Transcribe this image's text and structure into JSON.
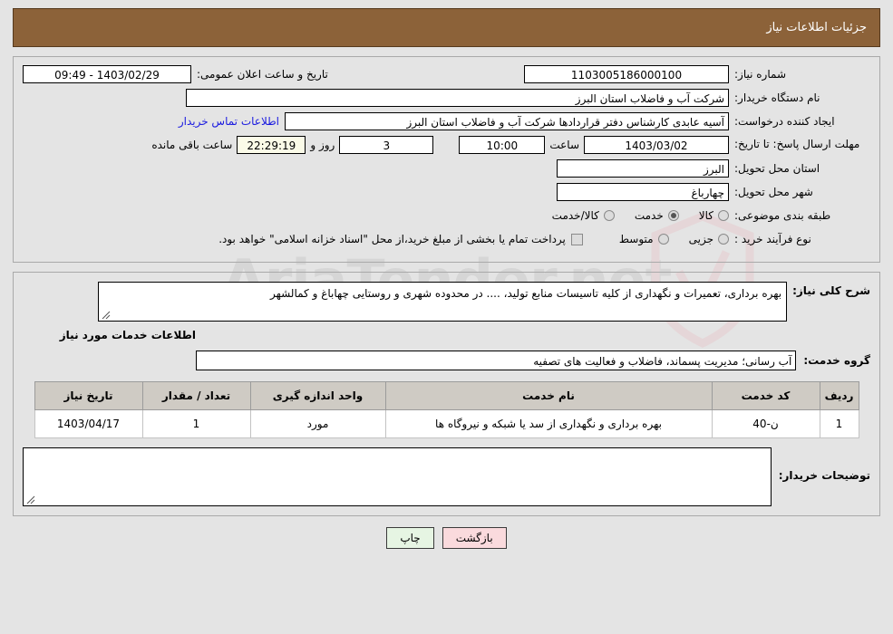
{
  "header": {
    "title": "جزئیات اطلاعات نیاز",
    "bg_color": "#8c6239",
    "text_color": "#ffffff"
  },
  "watermark": {
    "text": "AriaTender.net"
  },
  "form": {
    "need_number": {
      "label": "شماره نیاز:",
      "value": "1103005186000100"
    },
    "announce_datetime": {
      "label": "تاریخ و ساعت اعلان عمومی:",
      "value": "1403/02/29 - 09:49"
    },
    "buyer_org": {
      "label": "نام دستگاه خریدار:",
      "value": "شرکت آب و فاضلاب استان البرز"
    },
    "request_creator": {
      "label": "ایجاد کننده درخواست:",
      "value": "آسیه عابدی کارشناس دفتر قراردادها شرکت آب و فاضلاب استان البرز"
    },
    "empty_field": {
      "value": ""
    },
    "contact_link": {
      "label": "اطلاعات تماس خریدار",
      "color": "#1a1ae0"
    },
    "deadline": {
      "label": "مهلت ارسال پاسخ: تا تاریخ:",
      "date": "1403/03/02",
      "time_label": "ساعت",
      "time": "10:00",
      "days": "3",
      "days_label": "روز و",
      "countdown": "22:29:19",
      "countdown_suffix": "ساعت باقی مانده"
    },
    "delivery_province": {
      "label": "استان محل تحویل:",
      "value": "البرز"
    },
    "delivery_city": {
      "label": "شهر محل تحویل:",
      "value": "چهارباغ"
    },
    "subject_category": {
      "label": "طبقه بندی موضوعی:",
      "options": [
        "کالا",
        "خدمت",
        "کالا/خدمت"
      ],
      "selected": "خدمت"
    },
    "purchase_process": {
      "label": "نوع فرآیند خرید :",
      "options": [
        "جزیی",
        "متوسط"
      ],
      "selected": ""
    },
    "treasury_note": {
      "checked": false,
      "text": "پرداخت تمام یا بخشی از مبلغ خرید،از محل \"اسناد خزانه اسلامی\" خواهد بود."
    }
  },
  "details": {
    "general_description": {
      "label": "شرح کلی نیاز:",
      "value": "بهره برداری، تعمیرات و نگهداری از کلیه تاسیسات منابع تولید، .... در محدوده شهری و روستایی چهاباغ و کمالشهر"
    },
    "section_title": "اطلاعات خدمات مورد نیاز",
    "service_group": {
      "label": "گروه خدمت:",
      "value": "آب رسانی؛ مدیریت پسماند، فاضلاب و فعالیت های تصفیه"
    },
    "table": {
      "columns": [
        "ردیف",
        "کد خدمت",
        "نام خدمت",
        "واحد اندازه گیری",
        "تعداد / مقدار",
        "تاریخ نیاز"
      ],
      "rows": [
        {
          "row_no": "1",
          "service_code": "ن-40",
          "service_name": "بهره برداری و نگهداری از سد یا شبکه و نیروگاه ها",
          "unit": "مورد",
          "quantity": "1",
          "need_date": "1403/04/17"
        }
      ]
    },
    "buyer_notes": {
      "label": "توضیحات خریدار:",
      "value": ""
    }
  },
  "footer": {
    "back_button": "بازگشت",
    "print_button": "چاپ",
    "back_color": "#fadadd",
    "print_color": "#e6f5e3"
  }
}
